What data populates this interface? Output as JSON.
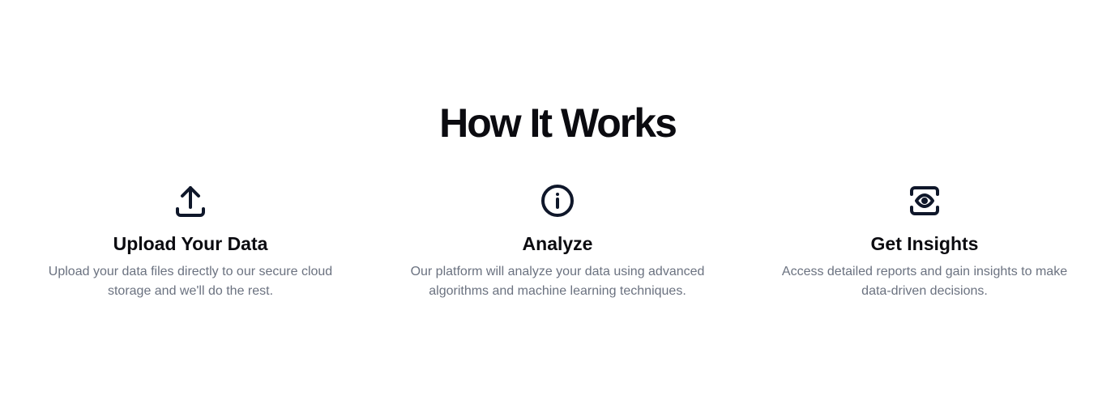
{
  "section": {
    "title": "How It Works"
  },
  "steps": [
    {
      "icon": "upload-icon",
      "title": "Upload Your Data",
      "description": "Upload your data files directly to our secure cloud storage and we'll do the rest."
    },
    {
      "icon": "info-icon",
      "title": "Analyze",
      "description": "Our platform will analyze your data using advanced algorithms and machine learning techniques."
    },
    {
      "icon": "eye-scan-icon",
      "title": "Get Insights",
      "description": "Access detailed reports and gain insights to make data-driven decisions."
    }
  ],
  "colors": {
    "heading": "#0b0b10",
    "icon_stroke": "#0f172a",
    "description": "#6b7280",
    "background": "#ffffff"
  }
}
